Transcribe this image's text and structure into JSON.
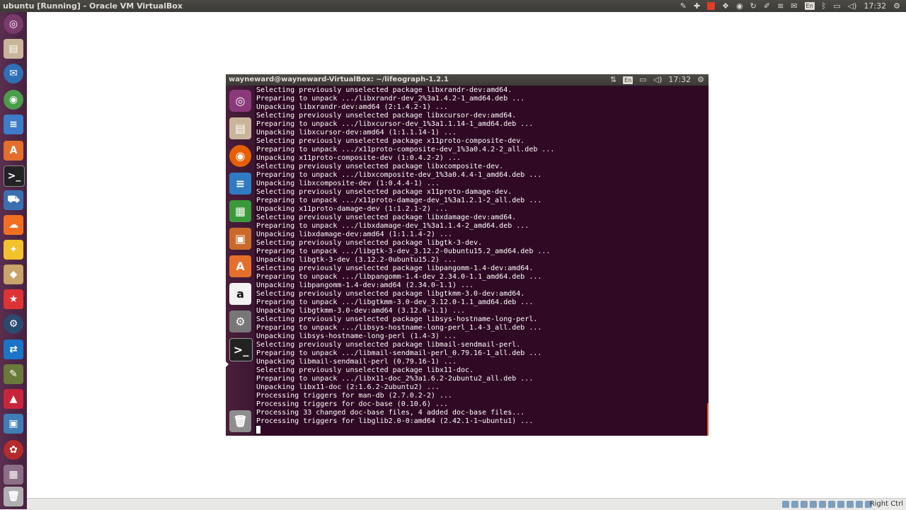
{
  "host": {
    "window_title": "ubuntu [Running] - Oracle VM VirtualBox",
    "keyboard": "En",
    "clock": "17:32",
    "right_ctrl": "Right Ctrl",
    "indicator_icons": [
      "edit-icon",
      "sync-icon",
      "red-square-icon",
      "dropbox-icon",
      "chrome-icon",
      "refresh-icon",
      "pen-icon",
      "wifi-icon",
      "mail-icon",
      "keyboard-icon",
      "bluetooth-icon",
      "battery-icon",
      "volume-icon",
      "clock",
      "gear-icon"
    ],
    "launcher_icons": [
      "ubuntu-dash-icon",
      "files-icon",
      "thunderbird-icon",
      "chrome-icon",
      "writer-icon",
      "software-center-icon",
      "terminal-icon",
      "car-icon",
      "soundcloud-icon",
      "idea-icon",
      "atlas-icon",
      "reminder-icon",
      "steam-icon",
      "teamviewer-icon",
      "pencil-icon",
      "inkscape-icon",
      "virtualbox-icon",
      "scribus-icon",
      "workspace-switcher-icon",
      "trash-icon"
    ],
    "colors": {
      "launcher": "#5a2e4f",
      "panel": "#3c3b37"
    }
  },
  "guest": {
    "panel_title": "wayneward@wayneward-VirtualBox: ~/lifeograph-1.2.1",
    "keyboard": "En",
    "clock": "17:32",
    "launcher_icons": [
      "ubuntu-dash-icon",
      "files-icon",
      "firefox-icon",
      "writer-icon",
      "calc-icon",
      "impress-icon",
      "software-center-icon",
      "amazon-icon",
      "system-settings-icon",
      "terminal-icon",
      "trash-icon"
    ],
    "terminal_lines": [
      "Selecting previously unselected package libxrandr-dev:amd64.",
      "Preparing to unpack .../libxrandr-dev_2%3a1.4.2-1_amd64.deb ...",
      "Unpacking libxrandr-dev:amd64 (2:1.4.2-1) ...",
      "Selecting previously unselected package libxcursor-dev:amd64.",
      "Preparing to unpack .../libxcursor-dev_1%3a1.1.14-1_amd64.deb ...",
      "Unpacking libxcursor-dev:amd64 (1:1.1.14-1) ...",
      "Selecting previously unselected package x11proto-composite-dev.",
      "Preparing to unpack .../x11proto-composite-dev_1%3a0.4.2-2_all.deb ...",
      "Unpacking x11proto-composite-dev (1:0.4.2-2) ...",
      "Selecting previously unselected package libxcomposite-dev.",
      "Preparing to unpack .../libxcomposite-dev_1%3a0.4.4-1_amd64.deb ...",
      "Unpacking libxcomposite-dev (1:0.4.4-1) ...",
      "Selecting previously unselected package x11proto-damage-dev.",
      "Preparing to unpack .../x11proto-damage-dev_1%3a1.2.1-2_all.deb ...",
      "Unpacking x11proto-damage-dev (1:1.2.1-2) ...",
      "Selecting previously unselected package libxdamage-dev:amd64.",
      "Preparing to unpack .../libxdamage-dev_1%3a1.1.4-2_amd64.deb ...",
      "Unpacking libxdamage-dev:amd64 (1:1.1.4-2) ...",
      "Selecting previously unselected package libgtk-3-dev.",
      "Preparing to unpack .../libgtk-3-dev_3.12.2-0ubuntu15.2_amd64.deb ...",
      "Unpacking libgtk-3-dev (3.12.2-0ubuntu15.2) ...",
      "Selecting previously unselected package libpangomm-1.4-dev:amd64.",
      "Preparing to unpack .../libpangomm-1.4-dev_2.34.0-1.1_amd64.deb ...",
      "Unpacking libpangomm-1.4-dev:amd64 (2.34.0-1.1) ...",
      "Selecting previously unselected package libgtkmm-3.0-dev:amd64.",
      "Preparing to unpack .../libgtkmm-3.0-dev_3.12.0-1.1_amd64.deb ...",
      "Unpacking libgtkmm-3.0-dev:amd64 (3.12.0-1.1) ...",
      "Selecting previously unselected package libsys-hostname-long-perl.",
      "Preparing to unpack .../libsys-hostname-long-perl_1.4-3_all.deb ...",
      "Unpacking libsys-hostname-long-perl (1.4-3) ...",
      "Selecting previously unselected package libmail-sendmail-perl.",
      "Preparing to unpack .../libmail-sendmail-perl_0.79.16-1_all.deb ...",
      "Unpacking libmail-sendmail-perl (0.79.16-1) ...",
      "Selecting previously unselected package libx11-doc.",
      "Preparing to unpack .../libx11-doc_2%3a1.6.2-2ubuntu2_all.deb ...",
      "Unpacking libx11-doc (2:1.6.2-2ubuntu2) ...",
      "Processing triggers for man-db (2.7.0.2-2) ...",
      "Processing triggers for doc-base (0.10.6) ...",
      "Processing 33 changed doc-base files, 4 added doc-base files...",
      "Processing triggers for libglib2.0-0:amd64 (2.42.1-1~ubuntu1) ..."
    ]
  }
}
